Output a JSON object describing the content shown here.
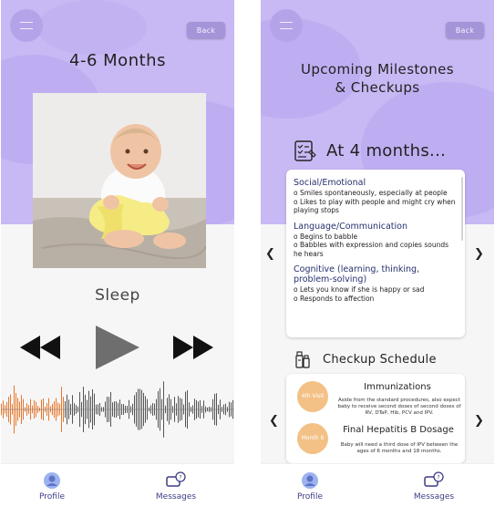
{
  "left": {
    "back_label": "Back",
    "title": "4-6 Months",
    "sound_label": "Sleep",
    "controls": {
      "rewind_icon": "rewind-icon",
      "play_icon": "play-icon",
      "fast_forward_icon": "fast-forward-icon"
    },
    "waveform_progress": 0.27,
    "colors": {
      "header": "#c8b8f4",
      "wave_played": "#e8772b",
      "wave_unplayed": "#555555"
    }
  },
  "right": {
    "back_label": "Back",
    "title_line1": "Upcoming Milestones",
    "title_line2": "& Checkups",
    "milestones_heading": "At 4 months...",
    "sections": [
      {
        "title": "Social/Emotional",
        "items": [
          "o Smiles spontaneously, especially at people",
          "o Likes to play with people and might cry when playing stops"
        ]
      },
      {
        "title": "Language/Communication",
        "items": [
          "o Begins to babble",
          "o Babbles with expression and copies sounds he hears"
        ]
      },
      {
        "title": "Cognitive (learning, thinking, problem-solving)",
        "items": [
          "o Lets you know if she is happy or sad",
          "o Responds to affection"
        ]
      }
    ],
    "checkup_heading": "Checkup Schedule",
    "checkups": [
      {
        "badge": "4th Visit",
        "title": "Immunizations",
        "desc": "Aside from the standard procedures, also expect baby to receive second doses of second doses of RV, DTaP, Hib, PCV and IPV."
      },
      {
        "badge": "Month 6",
        "title": "Final Hepatitis B Dosage",
        "desc": "Baby will need a third dose of IPV between the ages of 6 months and 18 months."
      }
    ],
    "colors": {
      "badge": "#f3c186",
      "section_title": "#27306e"
    }
  },
  "tabs": [
    {
      "label": "Profile",
      "icon": "profile-icon"
    },
    {
      "label": "Messages",
      "icon": "messages-icon"
    }
  ]
}
